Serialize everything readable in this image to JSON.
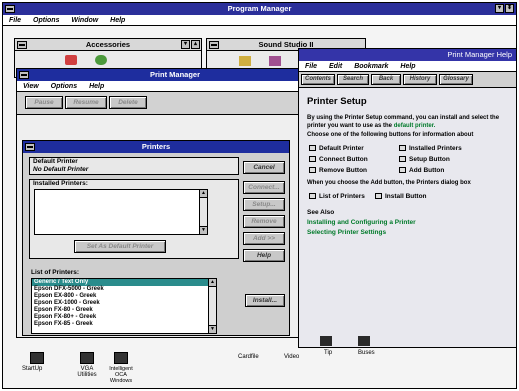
{
  "program_manager": {
    "title": "Program Manager",
    "menu": [
      "File",
      "Options",
      "Window",
      "Help"
    ]
  },
  "accessories": {
    "title": "Accessories"
  },
  "second_group": {
    "title": "Sound Studio II"
  },
  "print_manager": {
    "title": "Print Manager",
    "menu": [
      "View",
      "Options",
      "Help"
    ],
    "toolbar": [
      "Pause",
      "Resume",
      "Delete"
    ]
  },
  "printers_dialog": {
    "title": "Printers",
    "default_printer_label": "Default Printer",
    "default_printer_value": "No Default Printer",
    "installed_label": "Installed Printers:",
    "set_default_button": "Set As Default Printer",
    "list_label": "List of Printers:",
    "printer_list": [
      "Generic / Text Only",
      "Epson DFX-5000 - Greek",
      "Epson EX-800 - Greek",
      "Epson EX-1000 - Greek",
      "Epson FX-80 - Greek",
      "Epson FX-80+ - Greek",
      "Epson FX-85 - Greek"
    ],
    "buttons": [
      "Cancel",
      "Connect...",
      "Setup...",
      "Remove",
      "Add >>",
      "Help",
      "Install..."
    ]
  },
  "help_window": {
    "title": "Print Manager Help",
    "menu": [
      "File",
      "Edit",
      "Bookmark",
      "Help"
    ],
    "buttons": [
      "Contents",
      "Search",
      "Back",
      "History",
      "Glossary"
    ],
    "heading": "Printer Setup",
    "paragraph1": "By using the Printer Setup command, you can install and select the printer you want to use as the",
    "paragraph1_link": "default printer.",
    "paragraph2": "Choose one of the following buttons for information about",
    "options_left": [
      "Default Printer",
      "Connect Button",
      "Remove Button"
    ],
    "options_right": [
      "Installed Printers",
      "Setup Button",
      "Add Button"
    ],
    "add_note": "When you choose the Add button, the Printers dialog box",
    "options_extra_left": "List of Printers",
    "options_extra_right": "Install Button",
    "see_also": "See Also",
    "links": [
      "Installing and Configuring a Printer",
      "Selecting Printer Settings"
    ]
  },
  "bottom_icons": [
    {
      "label": "StartUp"
    },
    {
      "label": "VGA Utilities"
    },
    {
      "label": "Intelligent OCA Windows"
    },
    {
      "label": "Cardfile"
    },
    {
      "label": "Video"
    },
    {
      "label": "Tip"
    },
    {
      "label": "Buses"
    }
  ]
}
